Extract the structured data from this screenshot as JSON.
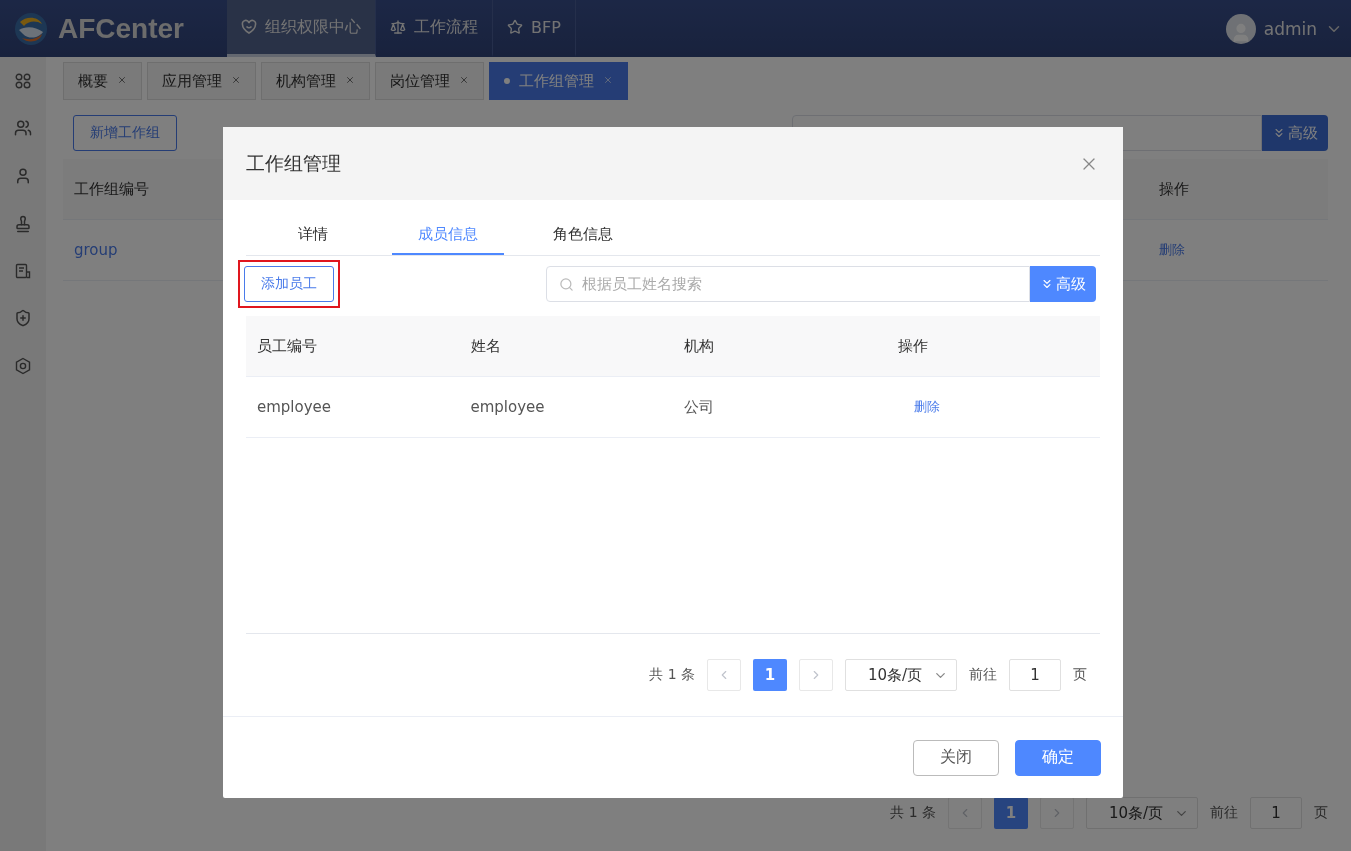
{
  "header": {
    "app_name": "AFCenter",
    "nav": [
      {
        "label": "组织权限中心",
        "selected": true
      },
      {
        "label": "工作流程",
        "selected": false
      },
      {
        "label": "BFP",
        "selected": false
      }
    ],
    "user": "admin"
  },
  "page_tabs": [
    {
      "label": "概要",
      "selected": false
    },
    {
      "label": "应用管理",
      "selected": false
    },
    {
      "label": "机构管理",
      "selected": false
    },
    {
      "label": "岗位管理",
      "selected": false
    },
    {
      "label": "工作组管理",
      "selected": true
    }
  ],
  "page": {
    "add_button": "新增工作组",
    "advanced_button": "高级",
    "table": {
      "columns": [
        "工作组编号",
        "操作"
      ],
      "rows": [
        {
          "cells": [
            "group",
            "删除"
          ]
        }
      ]
    },
    "pagination": {
      "total": "共 1 条",
      "pages": [
        {
          "label": "1",
          "selected": true
        }
      ],
      "page_size": "10条/页",
      "goto_label": "前往",
      "goto_value": "1",
      "page_unit": "页"
    }
  },
  "dialog": {
    "title": "工作组管理",
    "tabs": [
      {
        "label": "详情",
        "selected": false
      },
      {
        "label": "成员信息",
        "selected": true
      },
      {
        "label": "角色信息",
        "selected": false
      }
    ],
    "add_button": {
      "label": "添加员工",
      "highlighted": true
    },
    "search": {
      "placeholder": "根据员工姓名搜索"
    },
    "advanced_button": "高级",
    "table": {
      "columns": [
        "员工编号",
        "姓名",
        "机构",
        "操作"
      ],
      "rows": [
        {
          "cells": [
            "employee",
            "employee",
            "公司",
            "删除"
          ]
        }
      ]
    },
    "pagination": {
      "total": "共 1 条",
      "pages": [
        {
          "label": "1",
          "selected": true
        }
      ],
      "page_size": "10条/页",
      "goto_label": "前往",
      "goto_value": "1",
      "page_unit": "页"
    },
    "buttons": [
      {
        "label": "关闭",
        "kind": "secondary"
      },
      {
        "label": "确定",
        "kind": "primary"
      }
    ]
  }
}
